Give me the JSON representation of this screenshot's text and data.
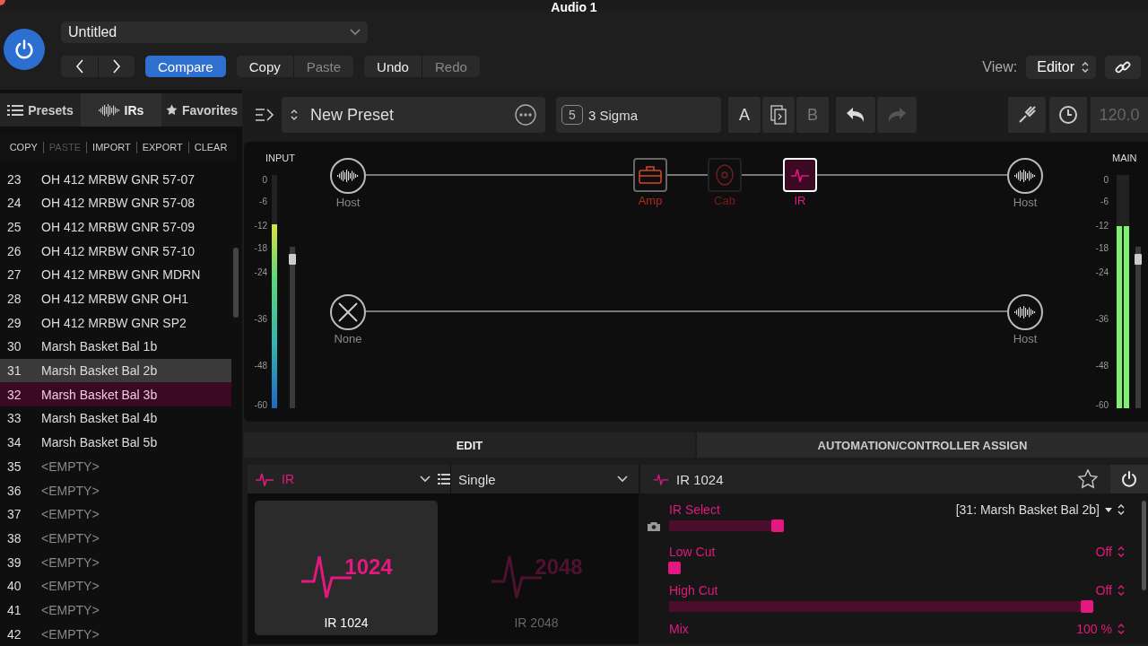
{
  "window": {
    "title": "Audio 1"
  },
  "header": {
    "preset_dropdown": "Untitled",
    "buttons": [
      {
        "label": "Compare",
        "selected": true,
        "disabled": false
      },
      {
        "label": "Copy",
        "selected": false,
        "disabled": false
      },
      {
        "label": "Paste",
        "selected": false,
        "disabled": true
      },
      {
        "label": "Undo",
        "selected": false,
        "disabled": false
      },
      {
        "label": "Redo",
        "selected": false,
        "disabled": true
      }
    ],
    "view_label": "View:",
    "view_dropdown": "Editor"
  },
  "sidebar": {
    "tabs": [
      {
        "label": "Presets",
        "selected": false
      },
      {
        "label": "IRs",
        "selected": true
      },
      {
        "label": "Favorites",
        "selected": false
      }
    ],
    "actions": [
      {
        "label": "COPY",
        "disabled": false
      },
      {
        "label": "PASTE",
        "disabled": true
      },
      {
        "label": "IMPORT",
        "disabled": false
      },
      {
        "label": "EXPORT",
        "disabled": false
      },
      {
        "label": "CLEAR",
        "disabled": false
      }
    ],
    "items": [
      {
        "number": "23",
        "name": "OH 412 MRBW GNR 57-07",
        "selected": false,
        "hovered": false,
        "empty": false
      },
      {
        "number": "24",
        "name": "OH 412 MRBW GNR 57-08",
        "selected": false,
        "hovered": false,
        "empty": false
      },
      {
        "number": "25",
        "name": "OH 412 MRBW GNR 57-09",
        "selected": false,
        "hovered": false,
        "empty": false
      },
      {
        "number": "26",
        "name": "OH 412 MRBW GNR 57-10",
        "selected": false,
        "hovered": false,
        "empty": false
      },
      {
        "number": "27",
        "name": "OH 412 MRBW GNR MDRN",
        "selected": false,
        "hovered": false,
        "empty": false
      },
      {
        "number": "28",
        "name": "OH 412 MRBW GNR OH1",
        "selected": false,
        "hovered": false,
        "empty": false
      },
      {
        "number": "29",
        "name": "OH 412 MRBW GNR SP2",
        "selected": false,
        "hovered": false,
        "empty": false
      },
      {
        "number": "30",
        "name": "Marsh Basket Bal 1b",
        "selected": false,
        "hovered": false,
        "empty": false
      },
      {
        "number": "31",
        "name": "Marsh Basket Bal 2b",
        "selected": false,
        "hovered": true,
        "empty": false
      },
      {
        "number": "32",
        "name": "Marsh Basket Bal 3b",
        "selected": true,
        "hovered": false,
        "empty": false
      },
      {
        "number": "33",
        "name": "Marsh Basket Bal 4b",
        "selected": false,
        "hovered": false,
        "empty": false
      },
      {
        "number": "34",
        "name": "Marsh Basket Bal 5b",
        "selected": false,
        "hovered": false,
        "empty": false
      },
      {
        "number": "35",
        "name": "<EMPTY>",
        "selected": false,
        "hovered": false,
        "empty": true
      },
      {
        "number": "36",
        "name": "<EMPTY>",
        "selected": false,
        "hovered": false,
        "empty": true
      },
      {
        "number": "37",
        "name": "<EMPTY>",
        "selected": false,
        "hovered": false,
        "empty": true
      },
      {
        "number": "38",
        "name": "<EMPTY>",
        "selected": false,
        "hovered": false,
        "empty": true
      },
      {
        "number": "39",
        "name": "<EMPTY>",
        "selected": false,
        "hovered": false,
        "empty": true
      },
      {
        "number": "40",
        "name": "<EMPTY>",
        "selected": false,
        "hovered": false,
        "empty": true
      },
      {
        "number": "41",
        "name": "<EMPTY>",
        "selected": false,
        "hovered": false,
        "empty": true
      },
      {
        "number": "42",
        "name": "<EMPTY>",
        "selected": false,
        "hovered": false,
        "empty": true
      }
    ]
  },
  "toolbar": {
    "preset_name": "New Preset",
    "snapshot": {
      "number": "5",
      "name": "3 Sigma"
    },
    "a_label": "A",
    "b_label": "B",
    "redo_disabled": true,
    "tempo": "120.0"
  },
  "signal_flow": {
    "input_meter": {
      "title": "INPUT",
      "scale": [
        "0",
        "-6",
        "-12",
        "-18",
        "-24",
        "-36",
        "-48",
        "-60"
      ],
      "level": 0.79,
      "fader": {
        "level": 0.93
      }
    },
    "nodes": [
      {
        "kind": "host",
        "label": "Host",
        "selected": false,
        "enabled": true
      },
      {
        "kind": "amp",
        "label": "Amp",
        "selected": false,
        "enabled": true
      },
      {
        "kind": "cab",
        "label": "Cab",
        "selected": false,
        "enabled": false
      },
      {
        "kind": "ir",
        "label": "IR",
        "selected": true,
        "enabled": true
      },
      {
        "kind": "host",
        "label": "Host",
        "selected": false,
        "enabled": true
      },
      {
        "kind": "none",
        "label": "None",
        "selected": false,
        "enabled": true
      },
      {
        "kind": "host",
        "label": "Host",
        "selected": false,
        "enabled": true
      }
    ],
    "main_meter": {
      "title": "MAIN",
      "scale": [
        "0",
        "-6",
        "-12",
        "-18",
        "-24",
        "-36",
        "-48",
        "-60"
      ],
      "level": 0.78,
      "fader": {
        "level": 0.93
      }
    }
  },
  "bottom_tabs": [
    {
      "label": "EDIT",
      "selected": true
    },
    {
      "label": "AUTOMATION/CONTROLLER ASSIGN",
      "selected": false
    }
  ],
  "editor": {
    "category": "IR",
    "mode": "Single",
    "tiles": [
      {
        "badge": "1024",
        "label": "IR 1024",
        "selected": true
      },
      {
        "badge": "2048",
        "label": "IR 2048",
        "selected": false
      }
    ],
    "block_title": "IR 1024",
    "params": [
      {
        "name": "IR Select",
        "value": "[31: Marsh Basket Bal 2b]",
        "level": 0.25,
        "snapshot": true,
        "dropdown": true
      },
      {
        "name": "Low Cut",
        "value": "Off",
        "level": 0,
        "snapshot": false,
        "dropdown": false
      },
      {
        "name": "High Cut",
        "value": "Off",
        "level": 1,
        "snapshot": false,
        "dropdown": false
      },
      {
        "name": "Mix",
        "value": "100 %",
        "snapshot": false,
        "dropdown": false
      }
    ]
  }
}
